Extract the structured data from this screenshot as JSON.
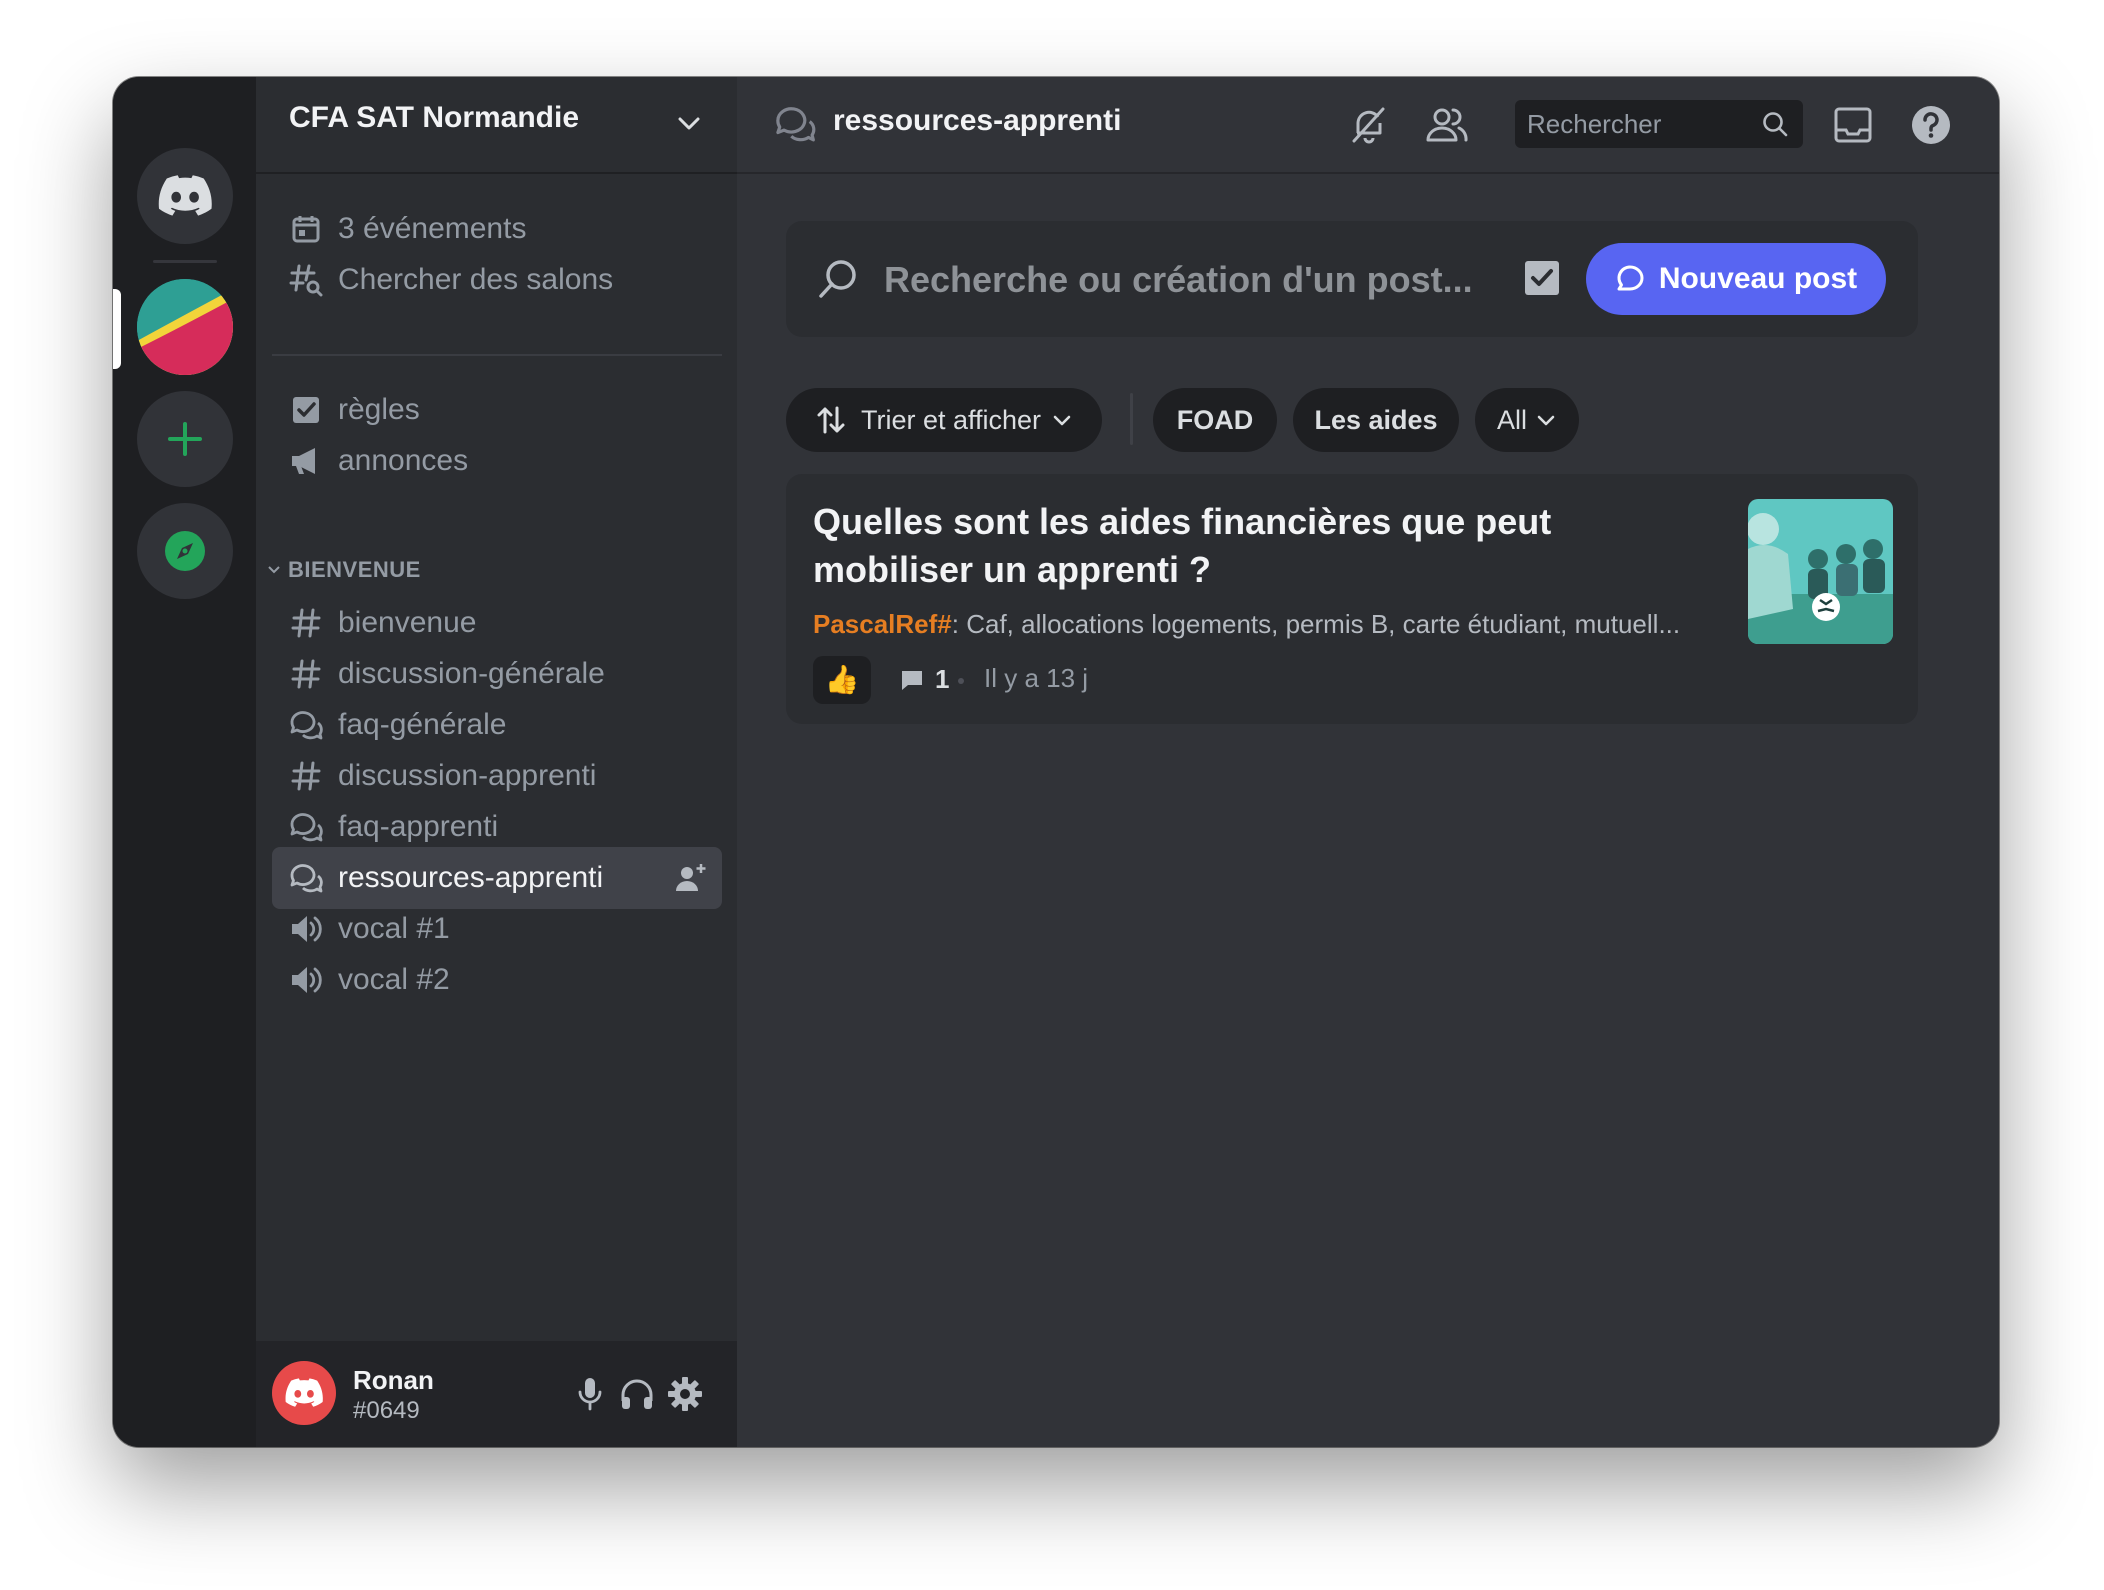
{
  "server": {
    "name": "CFA SAT Normandie"
  },
  "sidebar": {
    "top_items": [
      {
        "label": "3 événements",
        "icon": "calendar-icon"
      },
      {
        "label": "Chercher des salons",
        "icon": "channel-browse-icon"
      }
    ],
    "items": [
      {
        "label": "règles",
        "icon": "rules-icon"
      },
      {
        "label": "annonces",
        "icon": "megaphone-icon"
      }
    ],
    "category": "BIENVENUE",
    "channels": [
      {
        "label": "bienvenue",
        "icon": "hashtag-icon"
      },
      {
        "label": "discussion-générale",
        "icon": "hashtag-icon"
      },
      {
        "label": "faq-générale",
        "icon": "forum-icon"
      },
      {
        "label": "discussion-apprenti",
        "icon": "hashtag-icon"
      },
      {
        "label": "faq-apprenti",
        "icon": "forum-icon"
      },
      {
        "label": "ressources-apprenti",
        "icon": "forum-icon",
        "active": true
      },
      {
        "label": "vocal #1",
        "icon": "speaker-icon"
      },
      {
        "label": "vocal #2",
        "icon": "speaker-icon"
      }
    ]
  },
  "user": {
    "name": "Ronan",
    "tag": "#0649"
  },
  "topbar": {
    "channel": "ressources-apprenti",
    "search_placeholder": "Rechercher"
  },
  "forum": {
    "search_placeholder": "Recherche ou création d'un post...",
    "new_post_label": "Nouveau post",
    "sort_label": "Trier et afficher",
    "tags": [
      "FOAD",
      "Les aides"
    ],
    "all_label": "All"
  },
  "post": {
    "title": "Quelles sont les aides financières que peut mobiliser un apprenti ?",
    "author": "PascalRef#",
    "snippet": ": Caf, allocations logements, permis B, carte étudiant, mutuell...",
    "reaction": "👍",
    "message_count": "1",
    "age": "Il y a 13 j"
  },
  "colors": {
    "blurple": "#5865f2",
    "author": "#e67e22",
    "server_avatar": "#e74a4a"
  }
}
